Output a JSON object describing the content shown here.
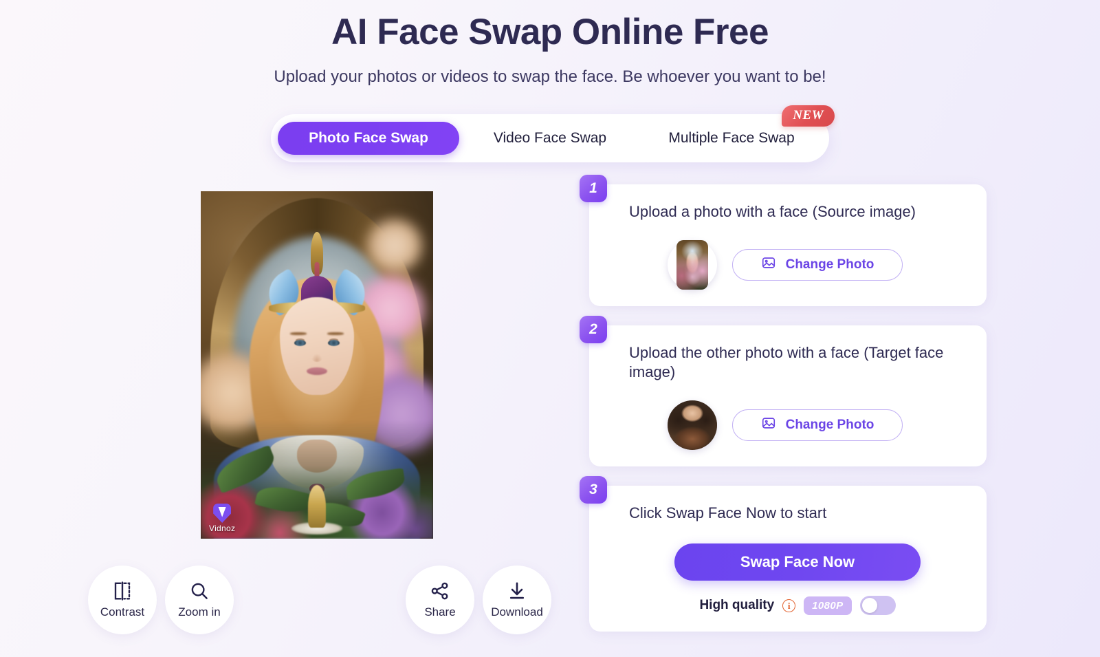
{
  "header": {
    "title": "AI Face Swap Online Free",
    "subtitle": "Upload your photos or videos to swap the face. Be whoever you want to be!"
  },
  "tabs": [
    {
      "label": "Photo Face Swap",
      "active": true,
      "badge": ""
    },
    {
      "label": "Video Face Swap",
      "active": false,
      "badge": ""
    },
    {
      "label": "Multiple Face Swap",
      "active": false,
      "badge": "NEW"
    }
  ],
  "preview": {
    "watermark": "Vidnoz",
    "watermark_icon": "vidnoz-logo-icon"
  },
  "toolbar": [
    {
      "label": "Contrast",
      "icon": "contrast-icon"
    },
    {
      "label": "Zoom in",
      "icon": "magnifier-icon"
    },
    {
      "label": "Share",
      "icon": "share-nodes-icon"
    },
    {
      "label": "Download",
      "icon": "download-arrow-icon"
    }
  ],
  "steps": [
    {
      "number": "1",
      "title": "Upload a photo with a face (Source image)",
      "thumb_name": "source-image-thumbnail",
      "button": "Change Photo",
      "button_icon": "image-icon"
    },
    {
      "number": "2",
      "title": "Upload the other photo with a face (Target face image)",
      "thumb_name": "target-image-thumbnail",
      "button": "Change Photo",
      "button_icon": "image-icon"
    },
    {
      "number": "3",
      "title": "Click Swap Face Now to start",
      "cta": "Swap Face Now",
      "quality_label": "High quality",
      "quality_info_icon": "info-icon",
      "resolution_badge": "1080P",
      "toggle_state": "off"
    }
  ],
  "colors": {
    "accent_purple": "#7c3ff2",
    "cta_purple": "#6b44ef",
    "title_navy": "#2e2a52",
    "badge_red": "#e04f52",
    "info_orange": "#e2622f",
    "res_badge_lilac": "#cdb6f5"
  }
}
